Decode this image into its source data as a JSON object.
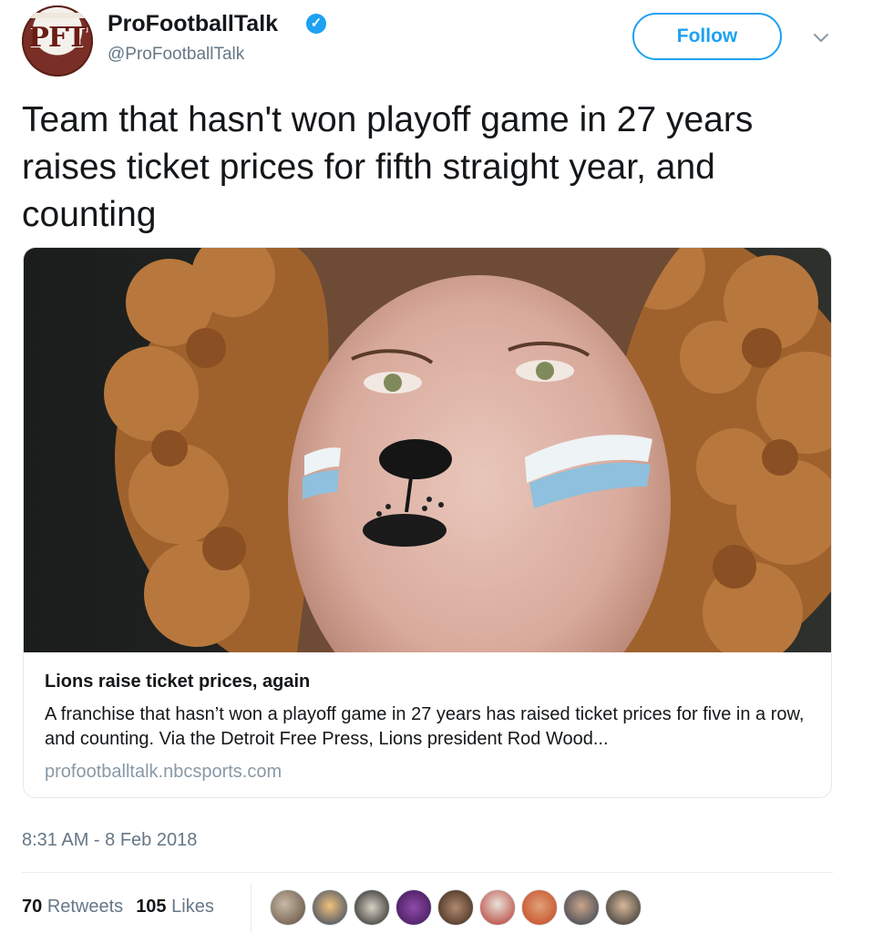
{
  "account": {
    "avatar_text": "PFT",
    "name": "ProFootballTalk",
    "handle": "@ProFootballTalk",
    "verified": true,
    "verified_icon": "check-badge-icon"
  },
  "actions": {
    "follow_label": "Follow",
    "more_icon": "chevron-down-icon"
  },
  "tweet": {
    "text": "Team that hasn't won playoff game in 27 years raises ticket prices for fifth straight year, and counting"
  },
  "card": {
    "image_description": "lion-fan-face-paint-photo",
    "title": "Lions raise ticket prices, again",
    "description": "A franchise that hasn’t won a playoff game in 27 years has raised ticket prices for five in a row, and counting. Via the Detroit Free Press, Lions president Rod Wood...",
    "domain": "profootballtalk.nbcsports.com"
  },
  "meta": {
    "timestamp": "8:31 AM - 8 Feb 2018"
  },
  "stats": {
    "retweets_count": "70",
    "retweets_label": "Retweets",
    "likes_count": "105",
    "likes_label": "Likes"
  },
  "colors": {
    "accent": "#1da1f2",
    "text": "#14171a",
    "muted": "#657786",
    "border": "#e1e8ed"
  }
}
